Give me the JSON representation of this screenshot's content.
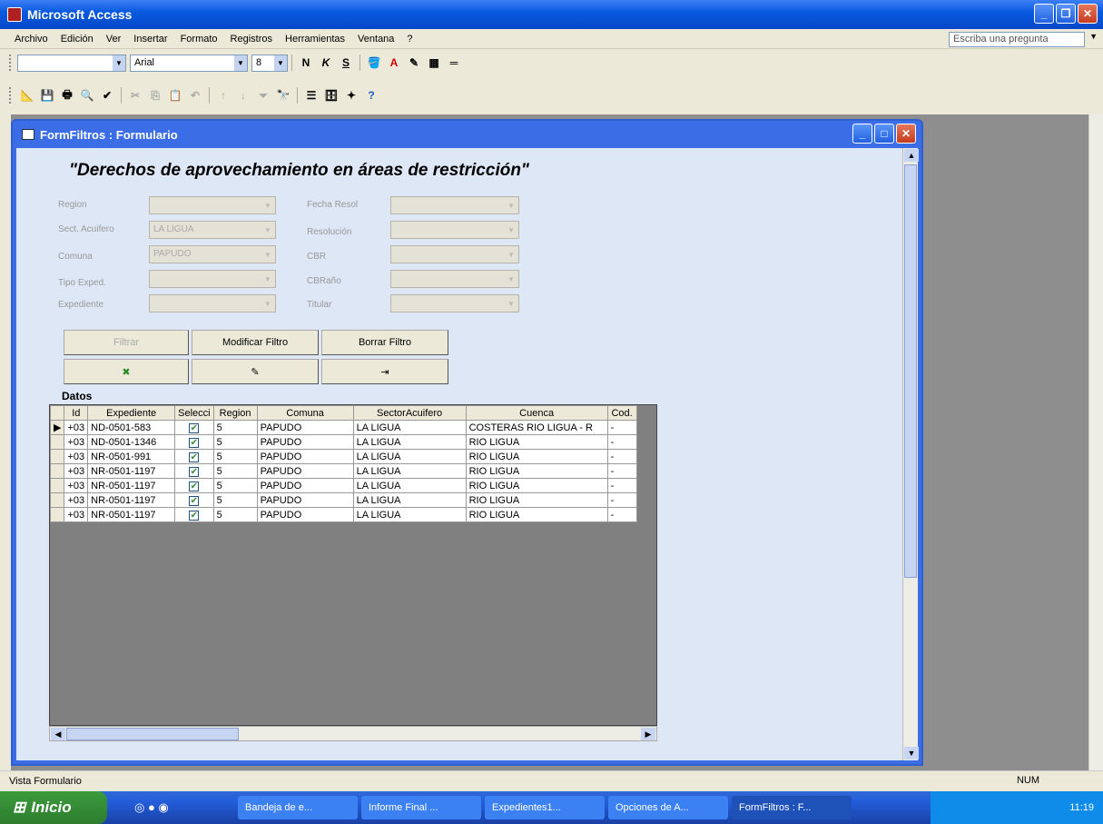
{
  "app": {
    "title": "Microsoft Access"
  },
  "menu": [
    "Archivo",
    "Edición",
    "Ver",
    "Insertar",
    "Formato",
    "Registros",
    "Herramientas",
    "Ventana",
    "?"
  ],
  "ask_placeholder": "Escriba una pregunta",
  "format_toolbar": {
    "font": "Arial",
    "size": "8",
    "bold": "N",
    "italic": "K",
    "underline": "S"
  },
  "form": {
    "window_title": "FormFiltros : Formulario",
    "header": "\"Derechos de aprovechamiento en áreas de restricción\"",
    "fields_left": [
      {
        "label": "Region",
        "value": ""
      },
      {
        "label": "Sect. Acuifero",
        "value": "LA LIGUA"
      },
      {
        "label": "Comuna",
        "value": "PAPUDO"
      },
      {
        "label": "Tipo Exped.",
        "value": ""
      },
      {
        "label": "Expediente",
        "value": ""
      }
    ],
    "fields_right": [
      {
        "label": "Fecha Resol",
        "value": ""
      },
      {
        "label": "Resolución",
        "value": ""
      },
      {
        "label": "CBR",
        "value": ""
      },
      {
        "label": "CBRaño",
        "value": ""
      },
      {
        "label": "Titular",
        "value": ""
      }
    ],
    "buttons": {
      "filtrar": "Filtrar",
      "modificar": "Modificar Filtro",
      "borrar": "Borrar Filtro"
    },
    "datos_label": "Datos",
    "columns": [
      "Id",
      "Expediente",
      "Selecci",
      "Region",
      "Comuna",
      "SectorAcuifero",
      "Cuenca",
      "Cod."
    ],
    "rows": [
      [
        "+03",
        "ND-0501-583",
        true,
        "5",
        "PAPUDO",
        "LA LIGUA",
        "COSTERAS RIO LIGUA - R",
        "-"
      ],
      [
        "+03",
        "ND-0501-1346",
        true,
        "5",
        "PAPUDO",
        "LA LIGUA",
        "RIO LIGUA",
        "-"
      ],
      [
        "+03",
        "NR-0501-991",
        true,
        "5",
        "PAPUDO",
        "LA LIGUA",
        "RIO LIGUA",
        "-"
      ],
      [
        "+03",
        "NR-0501-1197",
        true,
        "5",
        "PAPUDO",
        "LA LIGUA",
        "RIO LIGUA",
        "-"
      ],
      [
        "+03",
        "NR-0501-1197",
        true,
        "5",
        "PAPUDO",
        "LA LIGUA",
        "RIO LIGUA",
        "-"
      ],
      [
        "+03",
        "NR-0501-1197",
        true,
        "5",
        "PAPUDO",
        "LA LIGUA",
        "RIO LIGUA",
        "-"
      ],
      [
        "+03",
        "NR-0501-1197",
        true,
        "5",
        "PAPUDO",
        "LA LIGUA",
        "RIO LIGUA",
        "-"
      ]
    ]
  },
  "status": {
    "left": "Vista Formulario",
    "num": "NUM"
  },
  "taskbar": {
    "start": "Inicio",
    "tasks": [
      "Bandeja de e...",
      "Informe Final ...",
      "Expedientes1...",
      "Opciones de A...",
      "FormFiltros : F..."
    ],
    "clock": "11:19"
  }
}
